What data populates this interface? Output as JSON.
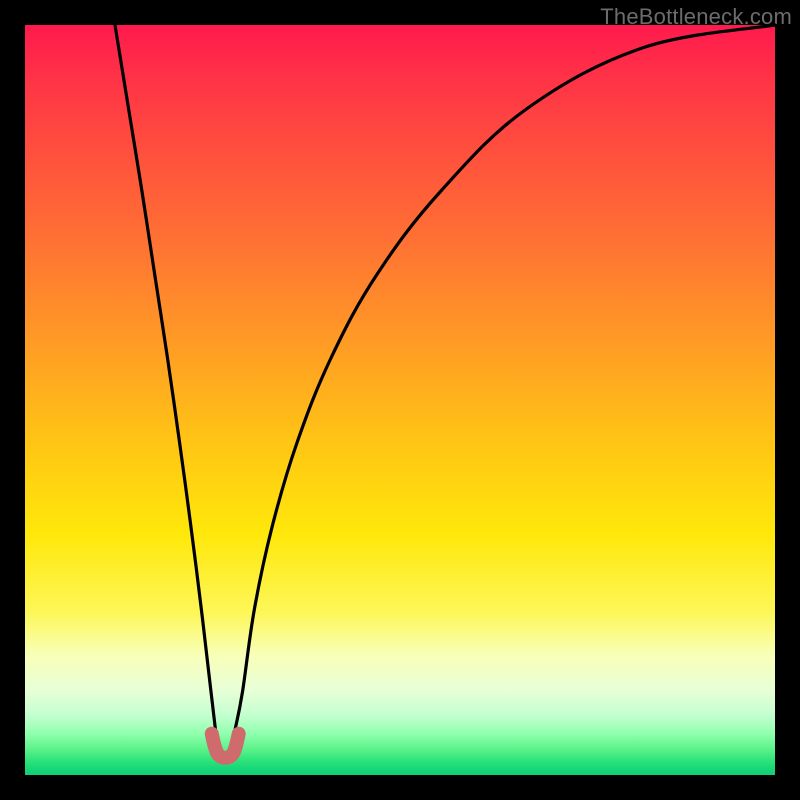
{
  "watermark": {
    "text": "TheBottleneck.com"
  },
  "colors": {
    "curve_stroke": "#000000",
    "marker_stroke": "#cf6a6d",
    "bg_black": "#000000"
  },
  "chart_data": {
    "type": "line",
    "title": "",
    "xlabel": "",
    "ylabel": "",
    "xlim": [
      0,
      100
    ],
    "ylim": [
      0,
      100
    ],
    "grid": false,
    "legend": false,
    "series": [
      {
        "name": "left-branch",
        "x": [
          12.0,
          13.8,
          15.6,
          17.3,
          19.0,
          20.6,
          22.1,
          23.5,
          24.8,
          25.4
        ],
        "y": [
          100.0,
          88.9,
          77.8,
          66.7,
          55.6,
          44.4,
          33.3,
          22.2,
          11.1,
          6.0
        ]
      },
      {
        "name": "right-branch",
        "x": [
          28.0,
          29.0,
          30.6,
          33.0,
          36.3,
          40.8,
          46.9,
          55.4,
          67.0,
          82.5,
          100.0
        ],
        "y": [
          6.0,
          11.1,
          22.2,
          33.3,
          44.4,
          55.6,
          66.7,
          77.8,
          88.9,
          97.0,
          100.0
        ]
      },
      {
        "name": "bottom-marker",
        "x": [
          24.9,
          25.3,
          25.7,
          26.2,
          26.7,
          27.2,
          27.7,
          28.1,
          28.5
        ],
        "y": [
          5.5,
          3.8,
          2.8,
          2.4,
          2.3,
          2.4,
          2.8,
          3.8,
          5.5
        ]
      }
    ]
  }
}
